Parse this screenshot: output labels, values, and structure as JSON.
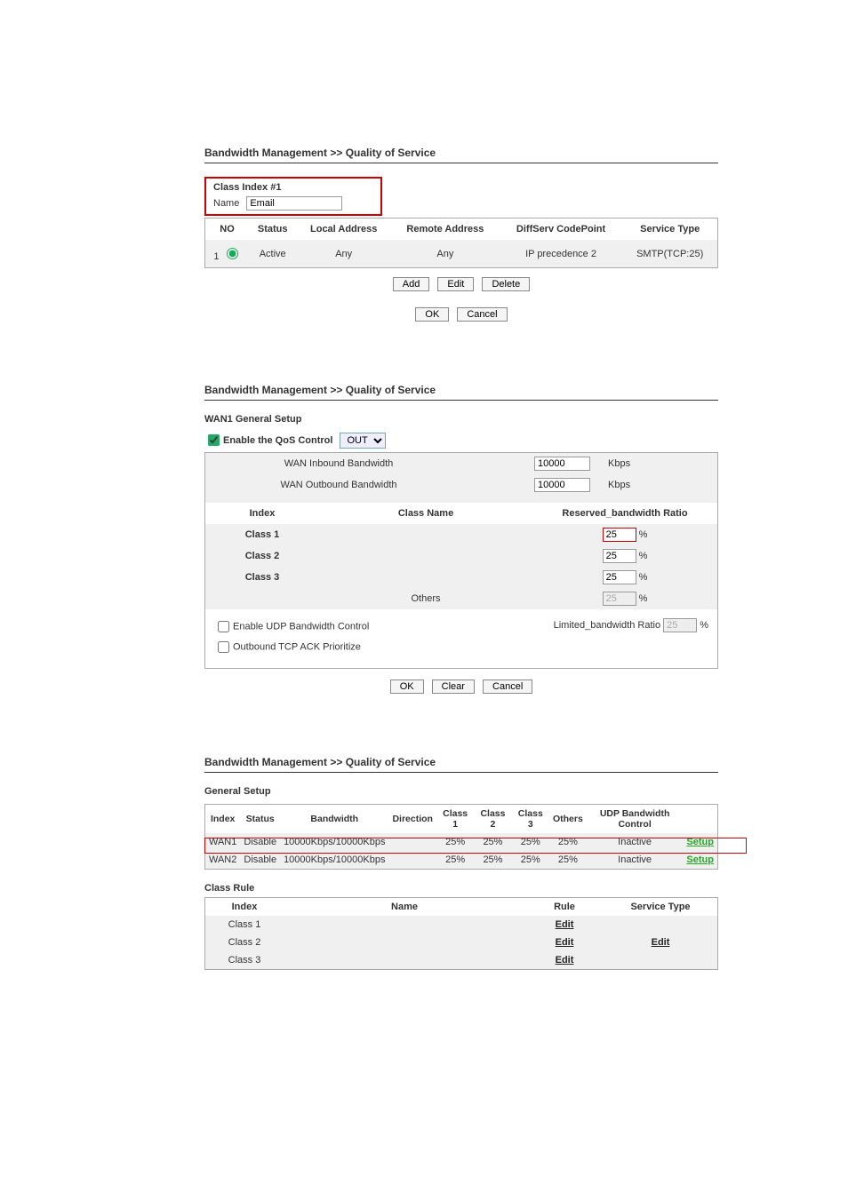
{
  "breadcrumb": "Bandwidth Management >> Quality of Service",
  "section1": {
    "class_index_title": "Class Index #1",
    "name_label": "Name",
    "name_value": "Email",
    "headers": {
      "no": "NO",
      "status": "Status",
      "local": "Local Address",
      "remote": "Remote Address",
      "diffserv": "DiffServ CodePoint",
      "service": "Service Type"
    },
    "row": {
      "no": "1",
      "status": "Active",
      "local": "Any",
      "remote": "Any",
      "diffserv": "IP precedence 2",
      "service": "SMTP(TCP:25)"
    },
    "buttons": {
      "add": "Add",
      "edit": "Edit",
      "delete": "Delete",
      "ok": "OK",
      "cancel": "Cancel"
    }
  },
  "section2": {
    "title": "WAN1 General Setup",
    "enable_label": "Enable the QoS Control",
    "select_value": "OUT",
    "inbound_label": "WAN Inbound Bandwidth",
    "outbound_label": "WAN Outbound Bandwidth",
    "inbound_value": "10000",
    "outbound_value": "10000",
    "kbps": "Kbps",
    "table_headers": {
      "index": "Index",
      "classname": "Class Name",
      "ratio": "Reserved_bandwidth Ratio"
    },
    "rows": [
      {
        "index": "Class 1",
        "name": "",
        "ratio": "25"
      },
      {
        "index": "Class 2",
        "name": "",
        "ratio": "25"
      },
      {
        "index": "Class 3",
        "name": "",
        "ratio": "25"
      },
      {
        "index": "",
        "name": "Others",
        "ratio": "25"
      }
    ],
    "percent": "%",
    "udp_label": "Enable UDP Bandwidth Control",
    "tcp_label": "Outbound TCP ACK Prioritize",
    "limited_label": "Limited_bandwidth Ratio",
    "limited_value": "25",
    "buttons": {
      "ok": "OK",
      "clear": "Clear",
      "cancel": "Cancel"
    }
  },
  "section3": {
    "general_title": "General Setup",
    "headers": {
      "index": "Index",
      "status": "Status",
      "bandwidth": "Bandwidth",
      "direction": "Direction",
      "c1": "Class 1",
      "c2": "Class 2",
      "c3": "Class 3",
      "others": "Others",
      "udp": "UDP Bandwidth Control",
      "setup": ""
    },
    "rows": [
      {
        "index": "WAN1",
        "status": "Disable",
        "bandwidth": "10000Kbps/10000Kbps",
        "direction": "",
        "c1": "25%",
        "c2": "25%",
        "c3": "25%",
        "others": "25%",
        "udp": "Inactive",
        "setup": "Setup"
      },
      {
        "index": "WAN2",
        "status": "Disable",
        "bandwidth": "10000Kbps/10000Kbps",
        "direction": "",
        "c1": "25%",
        "c2": "25%",
        "c3": "25%",
        "others": "25%",
        "udp": "Inactive",
        "setup": "Setup"
      }
    ],
    "class_rule_title": "Class Rule",
    "cr_headers": {
      "index": "Index",
      "name": "Name",
      "rule": "Rule",
      "service": "Service Type"
    },
    "cr_rows": [
      {
        "index": "Class 1",
        "name": "",
        "rule": "Edit"
      },
      {
        "index": "Class 2",
        "name": "",
        "rule": "Edit"
      },
      {
        "index": "Class 3",
        "name": "",
        "rule": "Edit"
      }
    ],
    "service_edit": "Edit"
  }
}
